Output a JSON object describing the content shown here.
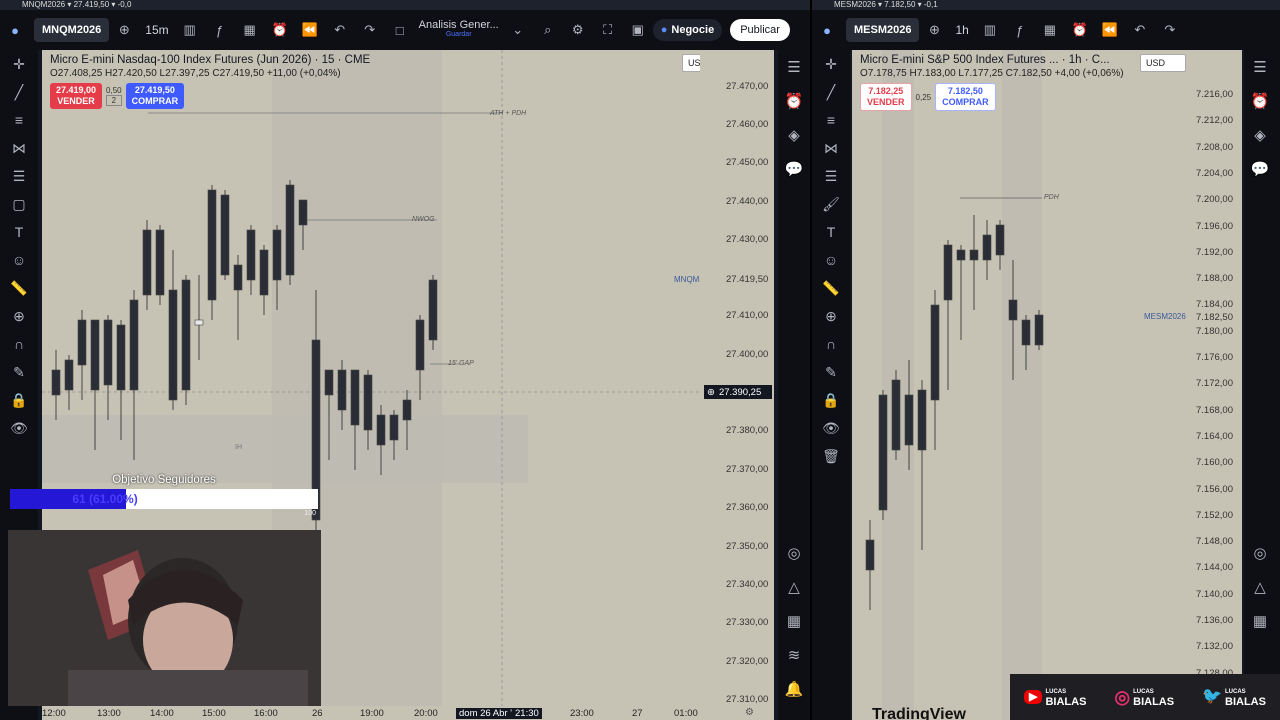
{
  "left_window": {
    "title": "MNQM2026 ▾ 27.419,50 ▾ -0,0",
    "symbol": "MNQM2026",
    "interval": "15m",
    "layout_name": "Analisis Gener...",
    "layout_sub": "Guardar",
    "trade_button": "Negocie",
    "publish_button": "Publicar",
    "chart": {
      "title": "Micro E-mini Nasdaq-100 Index Futures (Jun 2026) · 15 · CME",
      "ohlc": "O27.408,25 H27.420,50 L27.397,25 C27.419,50 +11,00 (+0,04%)",
      "sell_price": "27.419,00",
      "sell_label": "VENDER",
      "spread": "0,50",
      "qty": "2",
      "buy_price": "27.419,50",
      "buy_label": "COMPRAR",
      "currency": "USD",
      "annotations": [
        "ATH + PDH",
        "NWOG",
        "15' GAP",
        "IH"
      ],
      "price_labels": [
        "27.470,00",
        "27.460,00",
        "27.450,00",
        "27.440,00",
        "27.430,00",
        "27.410,00",
        "27.400,00",
        "27.380,00",
        "27.370,00",
        "27.360,00",
        "27.350,00",
        "27.340,00",
        "27.330,00",
        "27.320,00",
        "27.310,00"
      ],
      "last_symbol": "MNQM2026",
      "last_price": "27.419,50",
      "crosshair_price": "27.390,25",
      "time_labels": [
        "12:00",
        "13:00",
        "14:00",
        "15:00",
        "16:00",
        "26",
        "19:00",
        "20:00",
        "dom 26 Abr '26",
        "21:30",
        "23:00",
        "27",
        "01:00"
      ]
    },
    "overlay": {
      "follow_title": "Objetivo Seguidores",
      "follow_value": "61 (61.00%)",
      "follow_fraction": 0.61,
      "follow_max": "100"
    }
  },
  "right_window": {
    "title": "MESM2026 ▾ 7.182,50 ▾ -0,1",
    "symbol": "MESM2026",
    "interval": "1h",
    "chart": {
      "title": "Micro E-mini S&P 500 Index Futures ... · 1h · C...",
      "ohlc": "O7.178,75 H7.183,00 L7.177,25 C7.182,50 +4,00 (+0,06%)",
      "sell_price": "7.182,25",
      "sell_label": "VENDER",
      "spread": "0,25",
      "buy_price": "7.182,50",
      "buy_label": "COMPRAR",
      "currency": "USD",
      "annotations": [
        "PDH"
      ],
      "price_labels": [
        "7.216,00",
        "7.212,00",
        "7.208,00",
        "7.204,00",
        "7.200,00",
        "7.196,00",
        "7.192,00",
        "7.188,00",
        "7.184,00",
        "7.180,00",
        "7.176,00",
        "7.172,00",
        "7.168,00",
        "7.164,00",
        "7.160,00",
        "7.156,00",
        "7.152,00",
        "7.148,00",
        "7.144,00",
        "7.140,00",
        "7.136,00",
        "7.132,00",
        "7.128,00"
      ],
      "last_symbol": "MESM2026",
      "last_price": "7.182,50",
      "watermark": "TradingView"
    }
  },
  "social": {
    "youtube": {
      "top": "LUCAS",
      "name": "BIALAS"
    },
    "instagram": {
      "top": "LUCAS",
      "name": "BIALAS"
    },
    "twitter": {
      "top": "LUCAS",
      "name": "BIALAS"
    }
  },
  "colors": {
    "chart_bg": "#c7c3b4",
    "session_shade": "#b9b6ae",
    "bull_candle": "#e8e8e8",
    "bear_candle": "#2a2d35",
    "sell": "#e53c4a",
    "buy": "#3f5bff"
  }
}
